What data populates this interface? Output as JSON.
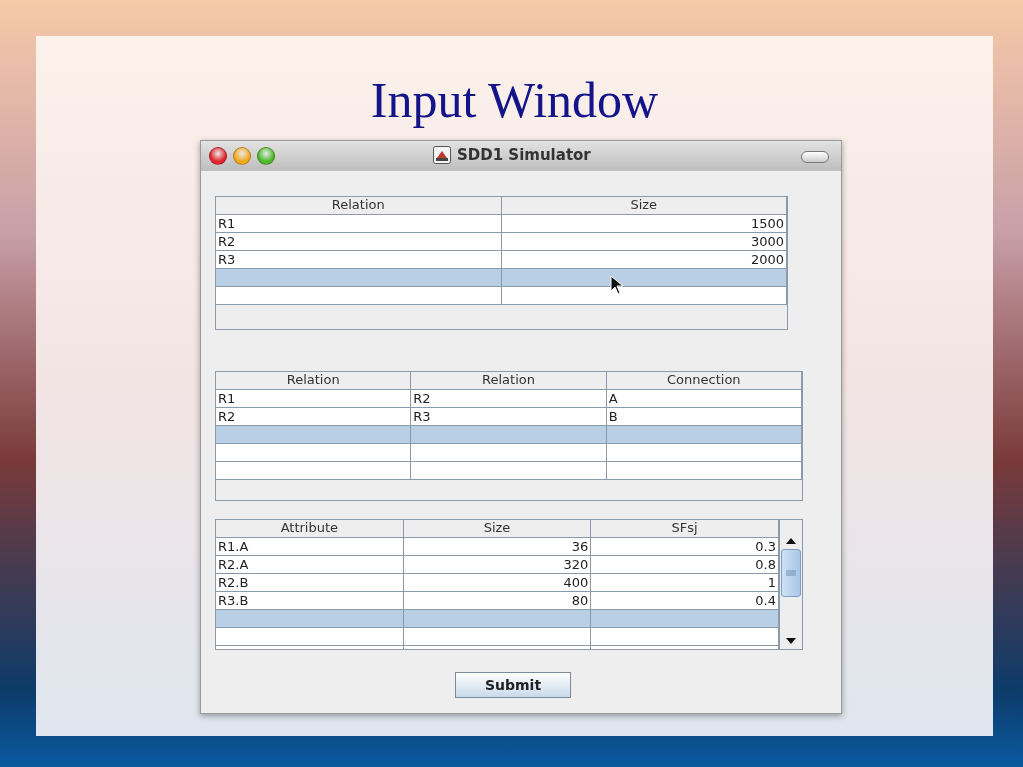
{
  "slide": {
    "title": "Input Window"
  },
  "window": {
    "title": "SDD1 Simulator"
  },
  "tables": [
    {
      "columns": [
        {
          "label": "Relation",
          "numeric": false
        },
        {
          "label": "Size",
          "numeric": true
        }
      ],
      "scrollbar": false,
      "rows": [
        {
          "cells": [
            "R1",
            "1500"
          ],
          "selected": false
        },
        {
          "cells": [
            "R2",
            "3000"
          ],
          "selected": false
        },
        {
          "cells": [
            "R3",
            "2000"
          ],
          "selected": false
        },
        {
          "selected": true
        },
        {
          "selected": false
        }
      ]
    },
    {
      "columns": [
        {
          "label": "Relation",
          "numeric": false
        },
        {
          "label": "Relation",
          "numeric": false
        },
        {
          "label": "Connection",
          "numeric": false
        }
      ],
      "scrollbar": false,
      "rows": [
        {
          "cells": [
            "R1",
            "R2",
            "A"
          ],
          "selected": false
        },
        {
          "cells": [
            "R2",
            "R3",
            "B"
          ],
          "selected": false
        },
        {
          "selected": true
        },
        {
          "selected": false
        },
        {
          "selected": false
        }
      ]
    },
    {
      "columns": [
        {
          "label": "Attribute",
          "numeric": false
        },
        {
          "label": "Size",
          "numeric": true
        },
        {
          "label": "SFsj",
          "numeric": true
        }
      ],
      "scrollbar": true,
      "rows": [
        {
          "cells": [
            "R1.A",
            "36",
            "0.3"
          ],
          "selected": false
        },
        {
          "cells": [
            "R2.A",
            "320",
            "0.8"
          ],
          "selected": false
        },
        {
          "cells": [
            "R2.B",
            "400",
            "1"
          ],
          "selected": false
        },
        {
          "cells": [
            "R3.B",
            "80",
            "0.4"
          ],
          "selected": false
        },
        {
          "selected": true
        },
        {
          "selected": false
        },
        {
          "selected": false
        }
      ]
    }
  ],
  "submit_button": "Submit"
}
